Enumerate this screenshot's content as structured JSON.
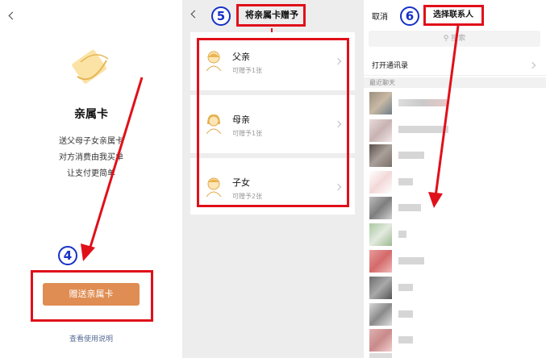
{
  "panel1": {
    "title": "亲属卡",
    "desc_lines": [
      "送父母子女亲属卡",
      "对方消费由我买单",
      "让支付更简单"
    ],
    "gift_button": "赠送亲属卡",
    "help_link": "查看使用说明",
    "step": "4"
  },
  "panel2": {
    "title": "将亲属卡赠予",
    "step": "5",
    "items": [
      {
        "name": "父亲",
        "sub": "可赠予1张"
      },
      {
        "name": "母亲",
        "sub": "可赠予1张"
      },
      {
        "name": "子女",
        "sub": "可赠予2张"
      }
    ]
  },
  "panel3": {
    "cancel": "取消",
    "title": "选择联系人",
    "step": "6",
    "search_placeholder": "搜索",
    "open_contacts": "打开通讯录",
    "recent": "最近聊天"
  },
  "colors": {
    "accent_button": "#df8d52",
    "annotation_red": "#e0101a",
    "annotation_blue": "#1530c8",
    "avatar_yellow": "#f2c87a"
  }
}
